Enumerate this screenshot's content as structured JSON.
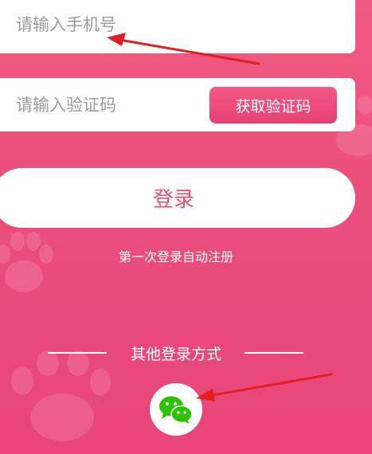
{
  "login": {
    "phone_placeholder": "请输入手机号",
    "code_placeholder": "请输入验证码",
    "get_code_label": "获取验证码",
    "submit_label": "登录",
    "register_hint": "第一次登录自动注册",
    "other_methods_label": "其他登录方式"
  },
  "icons": {
    "social": "wechat-icon",
    "decoration": "paw-print-icon"
  },
  "colors": {
    "background": "#eb4f7a",
    "accent": "#e84d72",
    "button_gradient_top": "#f25a84",
    "button_gradient_bottom": "#e64076",
    "wechat_green": "#2dc100",
    "annotation_arrow": "#e02020"
  }
}
